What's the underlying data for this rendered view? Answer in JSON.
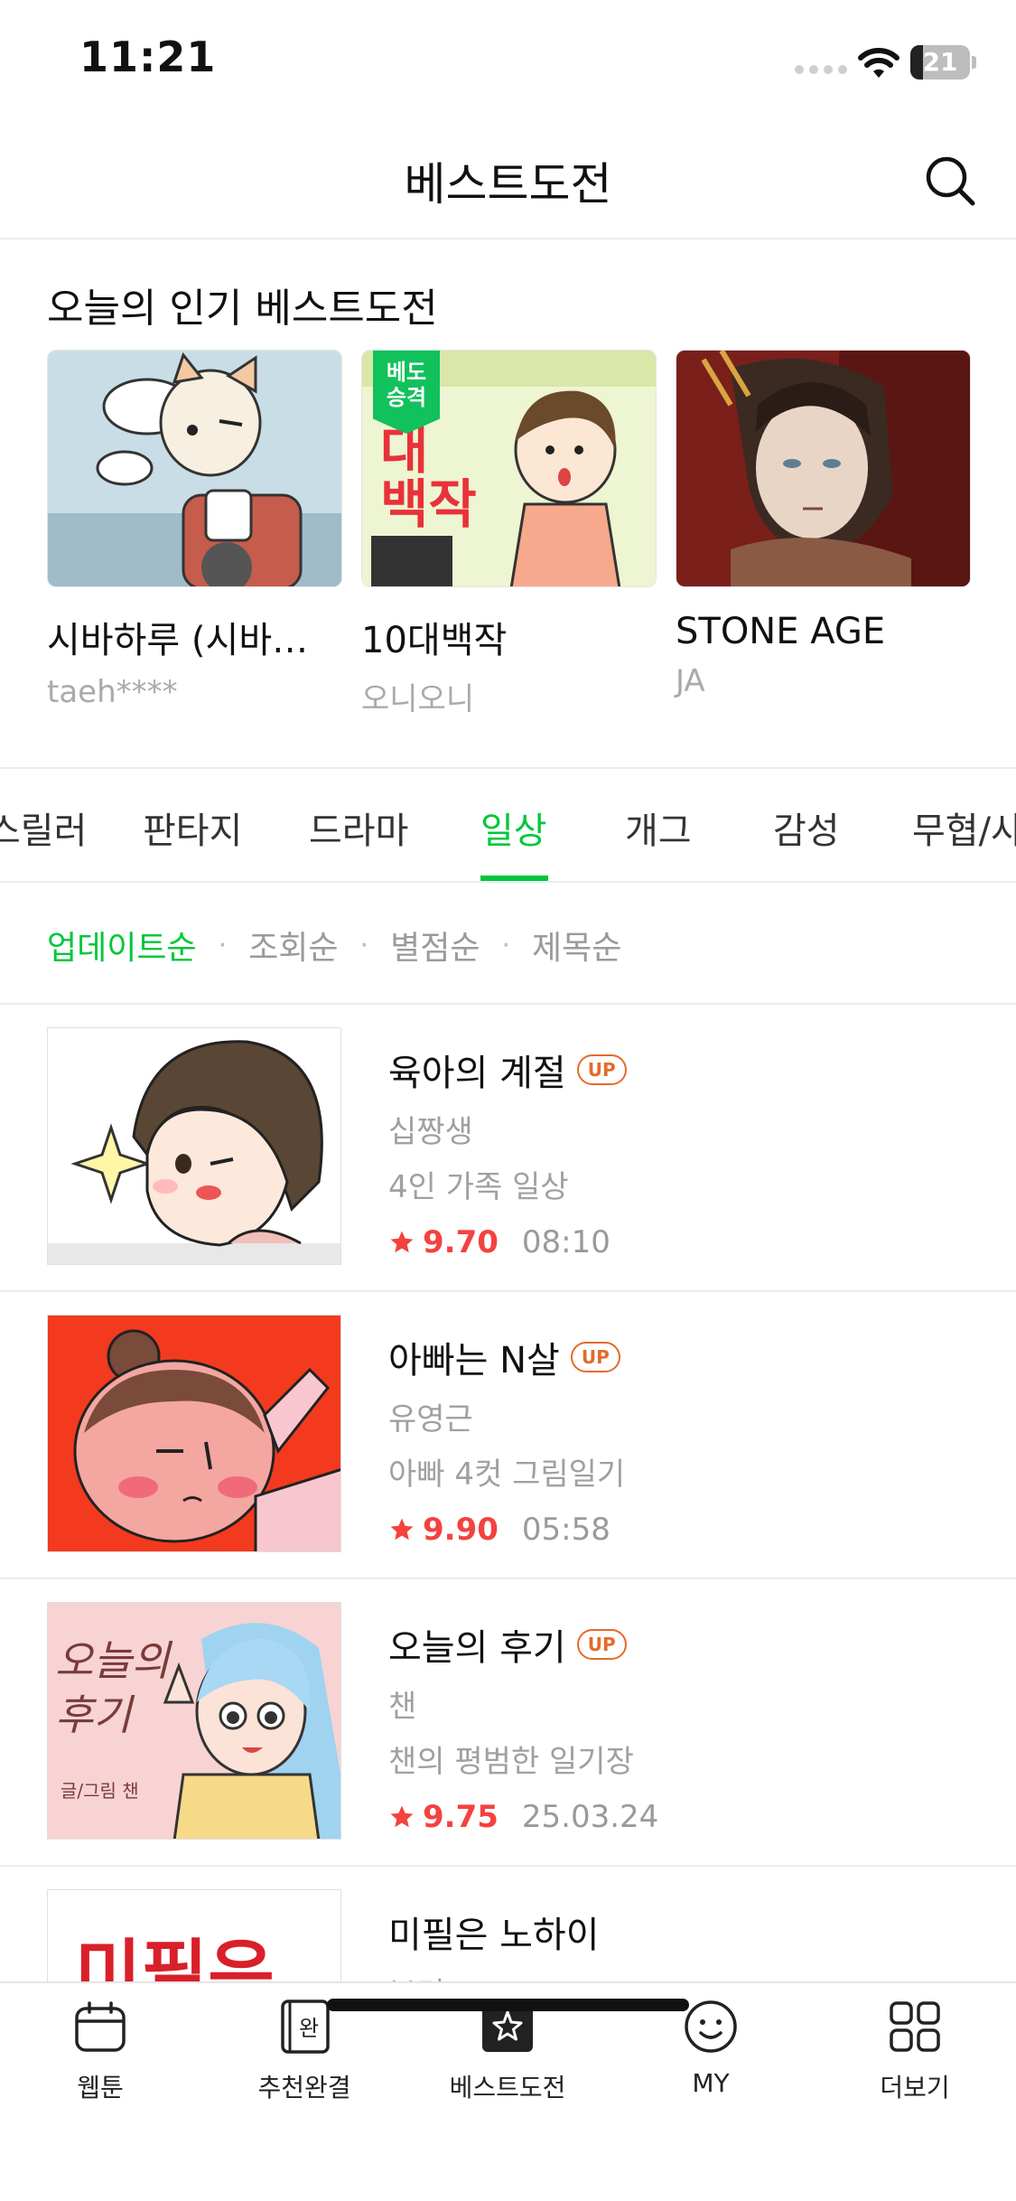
{
  "status": {
    "time": "11:21",
    "battery": "21",
    "battery_level": 0.21
  },
  "header": {
    "title": "베스트도전"
  },
  "popular": {
    "title": "오늘의 인기 베스트도전",
    "items": [
      {
        "title": "시바하루 (시바견…",
        "author": "taeh****"
      },
      {
        "title": "10대백작",
        "author": "오니오니",
        "badge": "베도\n승격"
      },
      {
        "title": "STONE AGE",
        "author": "JA"
      }
    ]
  },
  "genres": [
    "스릴러",
    "판타지",
    "드라마",
    "일상",
    "개그",
    "감성",
    "무협/사"
  ],
  "active_genre": "일상",
  "sort": {
    "items": [
      "업데이트순",
      "조회순",
      "별점순",
      "제목순"
    ],
    "active": "업데이트순"
  },
  "list": [
    {
      "title": "육아의 계절",
      "up": "UP",
      "author": "십짱생",
      "desc": "4인 가족 일상",
      "rating": "9.70",
      "date": "08:10"
    },
    {
      "title": "아빠는 N살",
      "up": "UP",
      "author": "유영근",
      "desc": "아빠 4컷 그림일기",
      "rating": "9.90",
      "date": "05:58"
    },
    {
      "title": "오늘의 후기",
      "up": "UP",
      "author": "챈",
      "desc": "챈의 평범한 일기장",
      "rating": "9.75",
      "date": "25.03.24"
    },
    {
      "title": "미필은 노하이",
      "author": "보며"
    }
  ],
  "thumb_texts": {
    "card2_text": "대\n백작",
    "row3_text": "오늘의\n후기",
    "row3_credit": "글/그림 챈",
    "row4_text": "미필은"
  },
  "tabbar": {
    "items": [
      {
        "label": "웹툰",
        "icon": "calendar-icon"
      },
      {
        "label": "추천완결",
        "icon": "book-complete-icon",
        "glyph": "완"
      },
      {
        "label": "베스트도전",
        "icon": "star-box-icon"
      },
      {
        "label": "MY",
        "icon": "smiley-icon"
      },
      {
        "label": "더보기",
        "icon": "grid-icon"
      }
    ]
  },
  "colors": {
    "accent": "#00c73c",
    "rating": "#f4423f",
    "up_badge": "#e46b2a"
  }
}
